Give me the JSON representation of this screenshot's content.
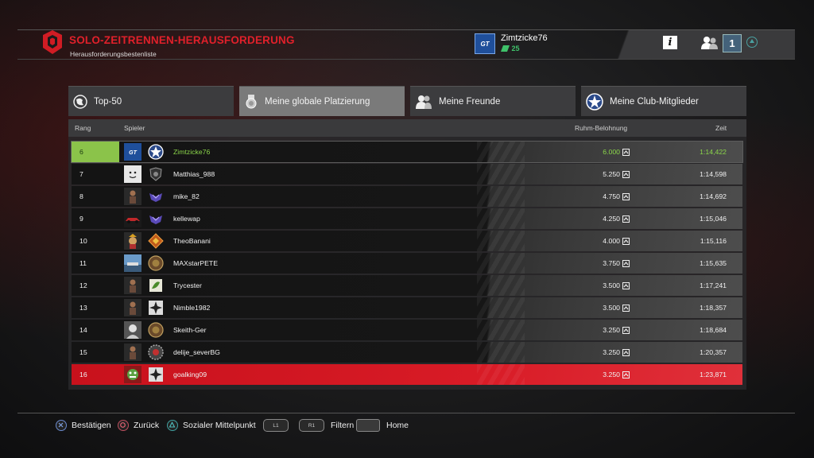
{
  "header": {
    "title": "SOLO-ZEITRENNEN-HERAUSFORDERUNG",
    "subtitle": "Herausforderungsbestenliste",
    "user": {
      "name": "Zimtzicke76",
      "level": "25",
      "avatar_text": "GT"
    },
    "info_label": "i",
    "notification_count": "1"
  },
  "tabs": [
    {
      "label": "Top-50",
      "icon": "globe-icon",
      "active": false
    },
    {
      "label": "Meine globale Platzierung",
      "icon": "medal-icon",
      "active": true
    },
    {
      "label": "Meine Freunde",
      "icon": "friends-icon",
      "active": false
    },
    {
      "label": "Meine Club-Mitglieder",
      "icon": "club-star-icon",
      "active": false
    }
  ],
  "table": {
    "headers": {
      "rank": "Rang",
      "player": "Spieler",
      "fame": "Ruhm-Belohnung",
      "time": "Zeit"
    },
    "rows": [
      {
        "rank": "6",
        "player": "Zimtzicke76",
        "fame": "6.000",
        "time": "1:14,422",
        "avatar": "gt-avatar",
        "badge": "club-star-badge"
      },
      {
        "rank": "7",
        "player": "Matthias_988",
        "fame": "5.250",
        "time": "1:14,598",
        "avatar": "smiley-avatar",
        "badge": "club-shield-badge"
      },
      {
        "rank": "8",
        "player": "mike_82",
        "fame": "4.750",
        "time": "1:14,692",
        "avatar": "figure-avatar",
        "badge": "club-wings-badge"
      },
      {
        "rank": "9",
        "player": "kellewap",
        "fame": "4.250",
        "time": "1:15,046",
        "avatar": "car-avatar",
        "badge": "club-wings-badge"
      },
      {
        "rank": "10",
        "player": "TheoBanani",
        "fame": "4.000",
        "time": "1:15,116",
        "avatar": "character-avatar",
        "badge": "club-diamond-badge"
      },
      {
        "rank": "11",
        "player": "MAXstarPETE",
        "fame": "3.750",
        "time": "1:15,635",
        "avatar": "landscape-avatar",
        "badge": "club-round-badge"
      },
      {
        "rank": "12",
        "player": "Trycester",
        "fame": "3.500",
        "time": "1:17,241",
        "avatar": "figure-avatar",
        "badge": "club-leaf-badge"
      },
      {
        "rank": "13",
        "player": "Nimble1982",
        "fame": "3.500",
        "time": "1:18,357",
        "avatar": "figure-avatar",
        "badge": "club-cross-badge"
      },
      {
        "rank": "14",
        "player": "Skeith-Ger",
        "fame": "3.250",
        "time": "1:18,684",
        "avatar": "portrait-avatar",
        "badge": "club-round-badge"
      },
      {
        "rank": "15",
        "player": "delije_severBG",
        "fame": "3.250",
        "time": "1:20,357",
        "avatar": "figure-avatar",
        "badge": "club-gear-badge"
      },
      {
        "rank": "16",
        "player": "goalking09",
        "fame": "3.250",
        "time": "1:23,871",
        "avatar": "monster-avatar",
        "badge": "club-cross-badge"
      }
    ]
  },
  "footer": {
    "confirm": {
      "label": "Bestätigen",
      "icon": "cross-button-icon"
    },
    "back": {
      "label": "Zurück",
      "icon": "circle-button-icon"
    },
    "social": {
      "label": "Sozialer Mittelpunkt",
      "icon": "triangle-button-icon"
    },
    "l1": "L1",
    "r1": "R1",
    "filter": {
      "label": "Filtern"
    },
    "home": {
      "label": "Home"
    }
  },
  "colors": {
    "accent_red": "#e0202a",
    "highlight_row": "#d81b26",
    "me_rank_green": "#8bc34a",
    "level_green": "#3fc16a"
  }
}
